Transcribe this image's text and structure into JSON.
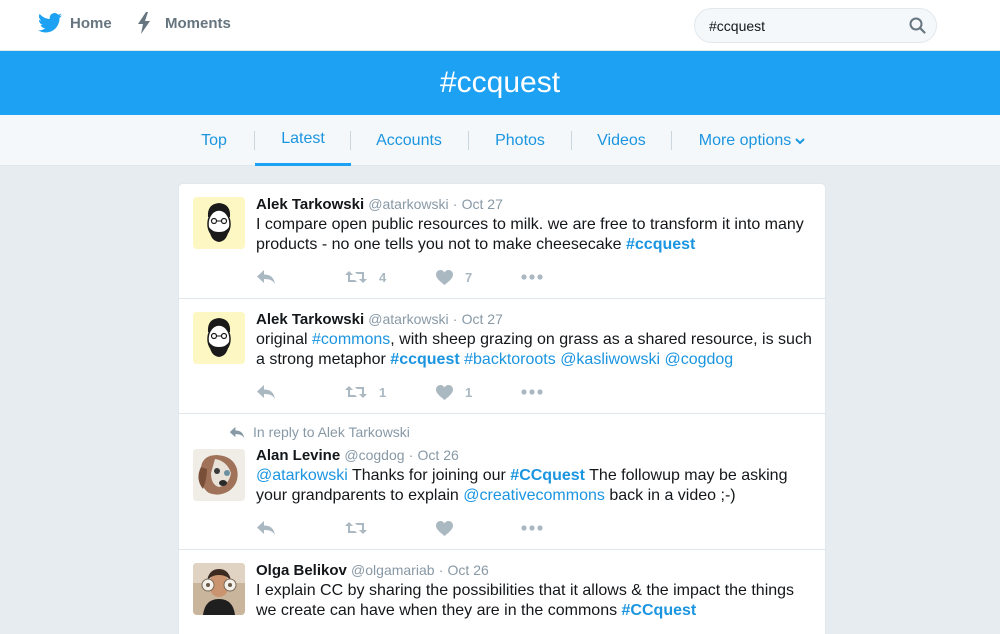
{
  "topnav": {
    "home_label": "Home",
    "moments_label": "Moments",
    "search_value": "#ccquest"
  },
  "banner": {
    "title": "#ccquest"
  },
  "tabs": [
    {
      "label": "Top"
    },
    {
      "label": "Latest"
    },
    {
      "label": "Accounts"
    },
    {
      "label": "Photos"
    },
    {
      "label": "Videos"
    },
    {
      "label": "More options"
    }
  ],
  "tweets": [
    {
      "name": "Alek Tarkowski",
      "handle": "@atarkowski",
      "dot": "·",
      "time": "Oct 27",
      "text_1": "I compare open public resources to milk. we are free to transform it into many products - no one tells you not to make cheesecake ",
      "tag_1": "#ccquest",
      "retweets": "4",
      "likes": "7"
    },
    {
      "name": "Alek Tarkowski",
      "handle": "@atarkowski",
      "dot": "·",
      "time": "Oct 27",
      "text_1": "original ",
      "tag_1": "#commons",
      "text_2": ", with sheep grazing on grass as a shared resource, is such a strong metaphor ",
      "tag_2": "#ccquest",
      "tag_3": "#backtoroots",
      "mention_1": "@kasliwowski",
      "mention_2": "@cogdog",
      "retweets": "1",
      "likes": "1"
    },
    {
      "reply_context": "In reply to Alek Tarkowski",
      "name": "Alan Levine",
      "handle": "@cogdog",
      "dot": "·",
      "time": "Oct 26",
      "mention_1": "@atarkowski",
      "text_1": " Thanks for joining our ",
      "tag_1": "#CCquest",
      "text_2": " The followup may be asking your grandparents to explain ",
      "mention_2": "@creativecommons",
      "text_3": " back in a video ;-)"
    },
    {
      "name": "Olga Belikov",
      "handle": "@olgamariab",
      "dot": "·",
      "time": "Oct 26",
      "text_1": "I explain CC by sharing the possibilities that it allows & the impact the things we create can have when they are in the commons ",
      "tag_1": "#CCquest"
    }
  ],
  "colors": {
    "brand_blue": "#1da1f2",
    "link_blue": "#1b95e0",
    "muted": "#8899a6",
    "icon_gray": "#aab8c2"
  },
  "icons": [
    "twitter-bird-icon",
    "lightning-icon",
    "search-icon",
    "chevron-down-icon",
    "reply-icon",
    "retweet-icon",
    "heart-icon",
    "more-icon"
  ]
}
